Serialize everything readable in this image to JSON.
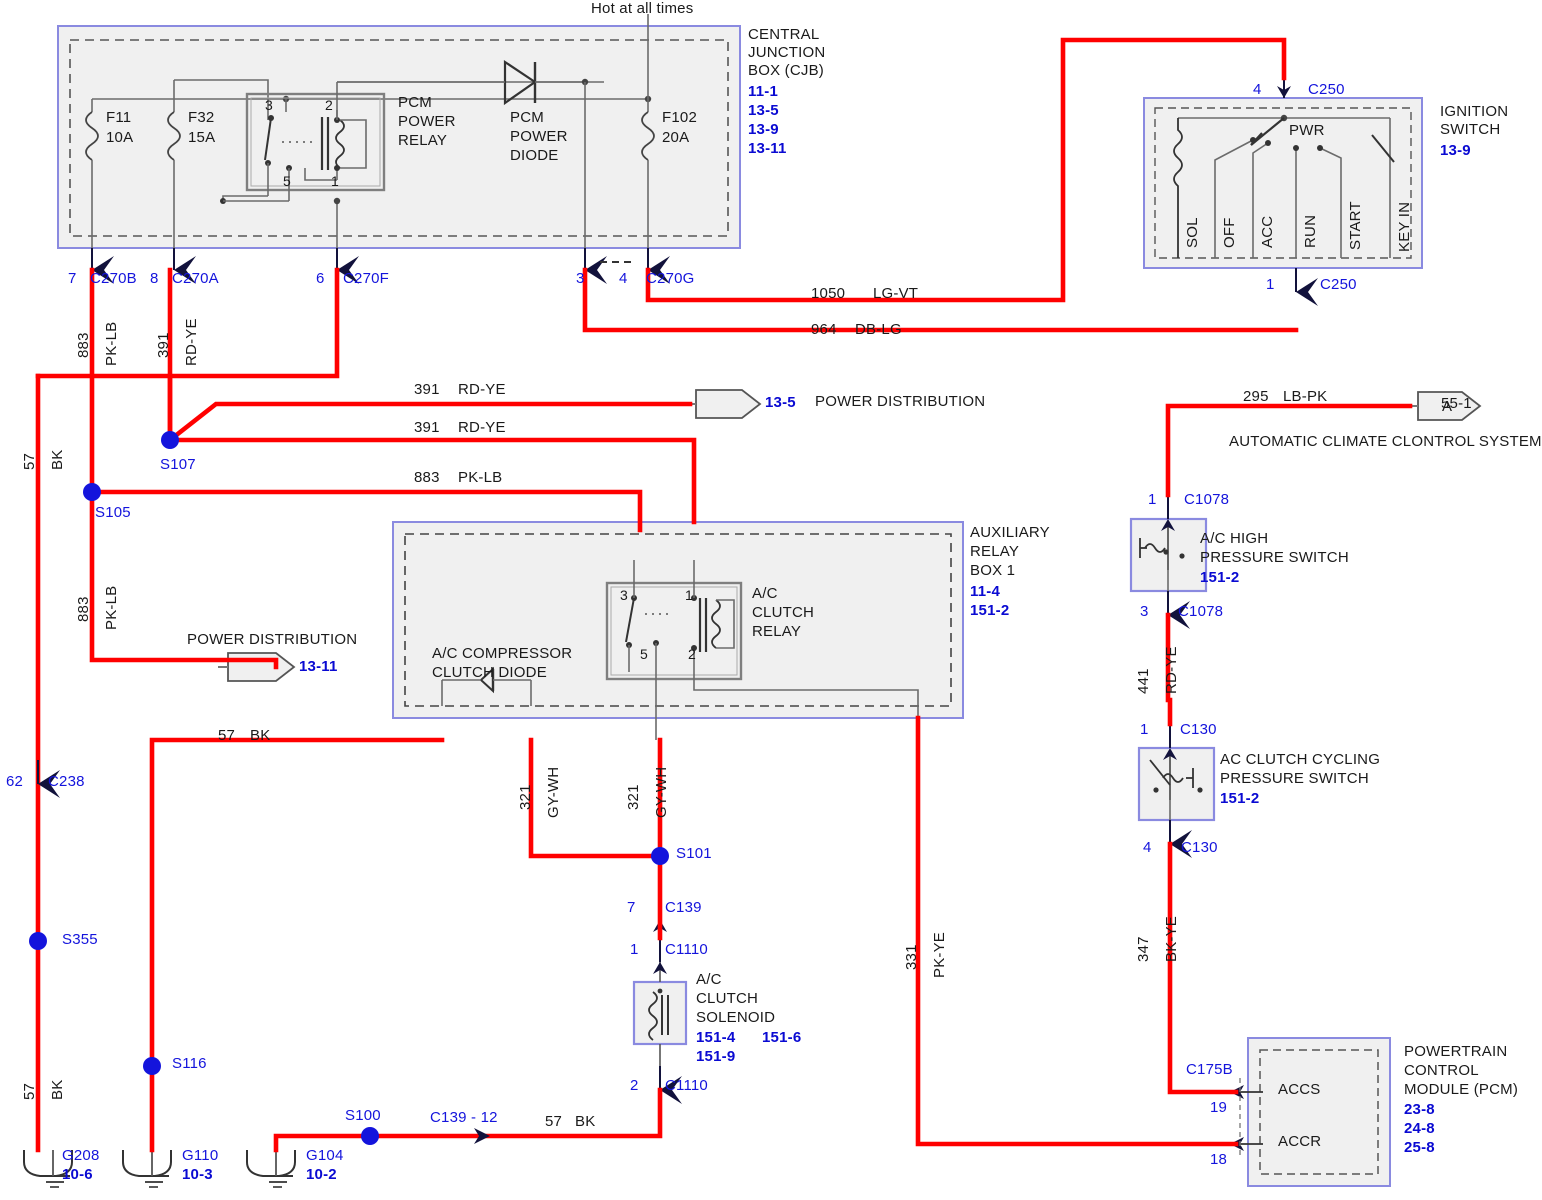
{
  "diagram": {
    "title_note": "Hot at all times",
    "colors": {
      "wire_red": "#ff0000",
      "wire_gray": "#6b6b6b",
      "label_blue": "#1414dc",
      "box_blue": "#8a8ae0",
      "box_fill": "#eeeeee"
    }
  },
  "modules": {
    "cjb": {
      "name_l1": "CENTRAL",
      "name_l2": "JUNCTION",
      "name_l3": "BOX (CJB)",
      "refs": [
        "11-1",
        "13-5",
        "13-9",
        "13-11"
      ]
    },
    "ignition_switch": {
      "name_l1": "IGNITION",
      "name_l2": "SWITCH",
      "refs": [
        "13-9"
      ],
      "pin_top": "4",
      "conn_top": "C250",
      "pin_bottom": "1",
      "conn_bottom": "C250",
      "pwr_label": "PWR",
      "positions": [
        "SOL",
        "OFF",
        "ACC",
        "RUN",
        "START",
        "KEY IN"
      ]
    },
    "aux_relay_box": {
      "name_l1": "AUXILIARY",
      "name_l2": "RELAY",
      "name_l3": "BOX 1",
      "refs": [
        "11-4",
        "151-2"
      ]
    },
    "pcm": {
      "name_l1": "POWERTRAIN",
      "name_l2": "CONTROL",
      "name_l3": "MODULE (PCM)",
      "refs": [
        "23-8",
        "24-8",
        "25-8"
      ],
      "conn": "C175B",
      "pin_accs": "19",
      "pin_accr": "18",
      "term_accs": "ACCS",
      "term_accr": "ACCR"
    }
  },
  "components": {
    "fuses": [
      {
        "id": "F11",
        "rating": "10A",
        "pin": "7",
        "conn": "C270B"
      },
      {
        "id": "F32",
        "rating": "15A",
        "pin": "8",
        "conn": "C270A"
      },
      {
        "id": "F102",
        "rating": "20A",
        "pin": "4",
        "conn": "C270G"
      }
    ],
    "pcm_power_relay": {
      "name_l1": "PCM",
      "name_l2": "POWER",
      "name_l3": "RELAY",
      "pins": [
        "3",
        "2",
        "5",
        "1"
      ],
      "out_pin": "6",
      "out_conn": "C270F"
    },
    "pcm_power_diode": {
      "name_l1": "PCM",
      "name_l2": "POWER",
      "name_l3": "DIODE",
      "pin": "3"
    },
    "ac_clutch_relay": {
      "name_l1": "A/C",
      "name_l2": "CLUTCH",
      "name_l3": "RELAY",
      "pins": [
        "3",
        "1",
        "5",
        "2"
      ]
    },
    "ac_compressor_clutch_diode": {
      "name_l1": "A/C COMPRESSOR",
      "name_l2": "CLUTCH DIODE"
    },
    "ac_high_pressure_switch": {
      "name_l1": "A/C HIGH",
      "name_l2": "PRESSURE SWITCH",
      "refs": [
        "151-2"
      ],
      "pin_top": "1",
      "conn_top": "C1078",
      "pin_bottom": "3",
      "conn_bottom": "C1078"
    },
    "ac_clutch_cycling_pressure_switch": {
      "name_l1": "AC CLUTCH CYCLING",
      "name_l2": "PRESSURE SWITCH",
      "refs": [
        "151-2"
      ],
      "pin_top": "1",
      "conn_top": "C130",
      "pin_bottom": "4",
      "conn_bottom": "C130"
    },
    "ac_clutch_solenoid": {
      "name_l1": "A/C",
      "name_l2": "CLUTCH",
      "name_l3": "SOLENOID",
      "refs": [
        "151-4",
        "151-6",
        "151-9"
      ],
      "pin_top": "1",
      "conn_top": "C1110",
      "pin_bottom": "2",
      "conn_bottom": "C1110",
      "upstream_pin": "7",
      "upstream_conn": "C139"
    }
  },
  "connectors": [
    {
      "pin": "7",
      "name": "C270B"
    },
    {
      "pin": "8",
      "name": "C270A"
    },
    {
      "pin": "6",
      "name": "C270F"
    },
    {
      "pin": "3",
      "name": ""
    },
    {
      "pin": "4",
      "name": "C270G"
    },
    {
      "pin": "62",
      "name": "C238"
    }
  ],
  "splices": [
    {
      "id": "S107"
    },
    {
      "id": "S105"
    },
    {
      "id": "S101"
    },
    {
      "id": "S355"
    },
    {
      "id": "S116"
    },
    {
      "id": "S100"
    }
  ],
  "grounds": [
    {
      "id": "G208",
      "ref": "10-6"
    },
    {
      "id": "G110",
      "ref": "10-3"
    },
    {
      "id": "G104",
      "ref": "10-2"
    }
  ],
  "wires": [
    {
      "number": "883",
      "color": "PK-LB",
      "where": "c270b-down"
    },
    {
      "number": "391",
      "color": "RD-YE",
      "where": "c270a-down"
    },
    {
      "number": "57",
      "color": "BK",
      "where": "left-vertical"
    },
    {
      "number": "883",
      "color": "PK-LB",
      "where": "s105-down"
    },
    {
      "number": "391",
      "color": "RD-YE",
      "where": "to-power-distribution-13-5"
    },
    {
      "number": "391",
      "color": "RD-YE",
      "where": "s107-right"
    },
    {
      "number": "883",
      "color": "PK-LB",
      "where": "s105-right"
    },
    {
      "number": "1050",
      "color": "LG-VT",
      "where": "cjb-to-ignition-top"
    },
    {
      "number": "964",
      "color": "DB-LG",
      "where": "cjb-to-ignition-bottom"
    },
    {
      "number": "295",
      "color": "LB-PK",
      "where": "to-automatic-climate-control"
    },
    {
      "number": "441",
      "color": "RD-YE",
      "where": "hps-to-ccps"
    },
    {
      "number": "347",
      "color": "BK-YE",
      "where": "ccps-to-pcm-accs"
    },
    {
      "number": "321",
      "color": "GY-WH",
      "where": "relay-pin5-down"
    },
    {
      "number": "321",
      "color": "GY-WH",
      "where": "relay-diode-down"
    },
    {
      "number": "331",
      "color": "PK-YE",
      "where": "relay-to-pcm-accr"
    },
    {
      "number": "57",
      "color": "BK",
      "where": "diode-ground-run"
    },
    {
      "number": "57",
      "color": "BK",
      "where": "solenoid-ground-run"
    },
    {
      "number": "57",
      "color": "BK",
      "where": "c238-to-g208"
    }
  ],
  "destinations": [
    {
      "label": "POWER DISTRIBUTION",
      "ref": "13-5"
    },
    {
      "label": "POWER DISTRIBUTION",
      "ref": "13-11"
    },
    {
      "label": "AUTOMATIC CLIMATE CLONTROL SYSTEM",
      "ref": "55-1",
      "letter": "A"
    }
  ],
  "inline_labels": {
    "c139_12": "C139 - 12",
    "hot_all_times": "Hot at all times"
  }
}
